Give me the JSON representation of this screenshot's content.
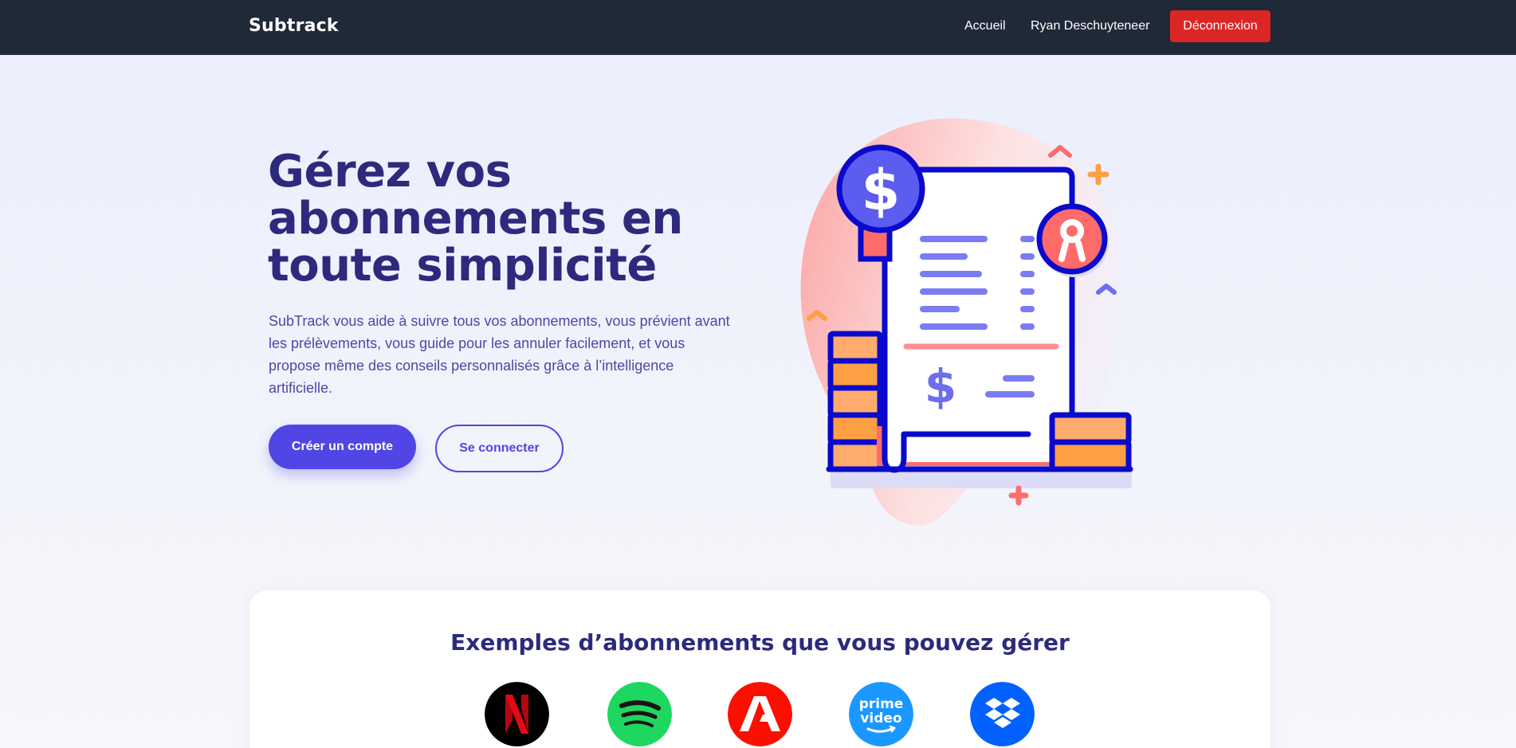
{
  "navbar": {
    "brand": "Subtrack",
    "home_label": "Accueil",
    "user_name": "Ryan Deschuyteneer",
    "logout_label": "Déconnexion",
    "logout_color": "#dc2626",
    "background": "#1f2937"
  },
  "hero": {
    "title": "Gérez vos abonnements en toute simplicité",
    "description": "SubTrack vous aide à suivre tous vos abonnements, vous prévient avant les prélèvements, vous guide pour les annuler facilement, et vous propose même des conseils personnalisés grâce à l’intelligence artificielle.",
    "primary_button": "Créer un compte",
    "secondary_button": "Se connecter",
    "accent_color": "#4f46e5",
    "illustration": "bill-receipt-illustration"
  },
  "examples": {
    "title": "Exemples d’abonnements que vous pouvez gérer",
    "logos": [
      {
        "icon": "netflix-logo",
        "color": "#000000"
      },
      {
        "icon": "spotify-logo",
        "color": "#1ed760"
      },
      {
        "icon": "adobe-logo",
        "color": "#fa0f00"
      },
      {
        "icon": "prime-video-logo",
        "color": "#1a98ff"
      },
      {
        "icon": "dropbox-logo",
        "color": "#0061fe"
      }
    ]
  }
}
